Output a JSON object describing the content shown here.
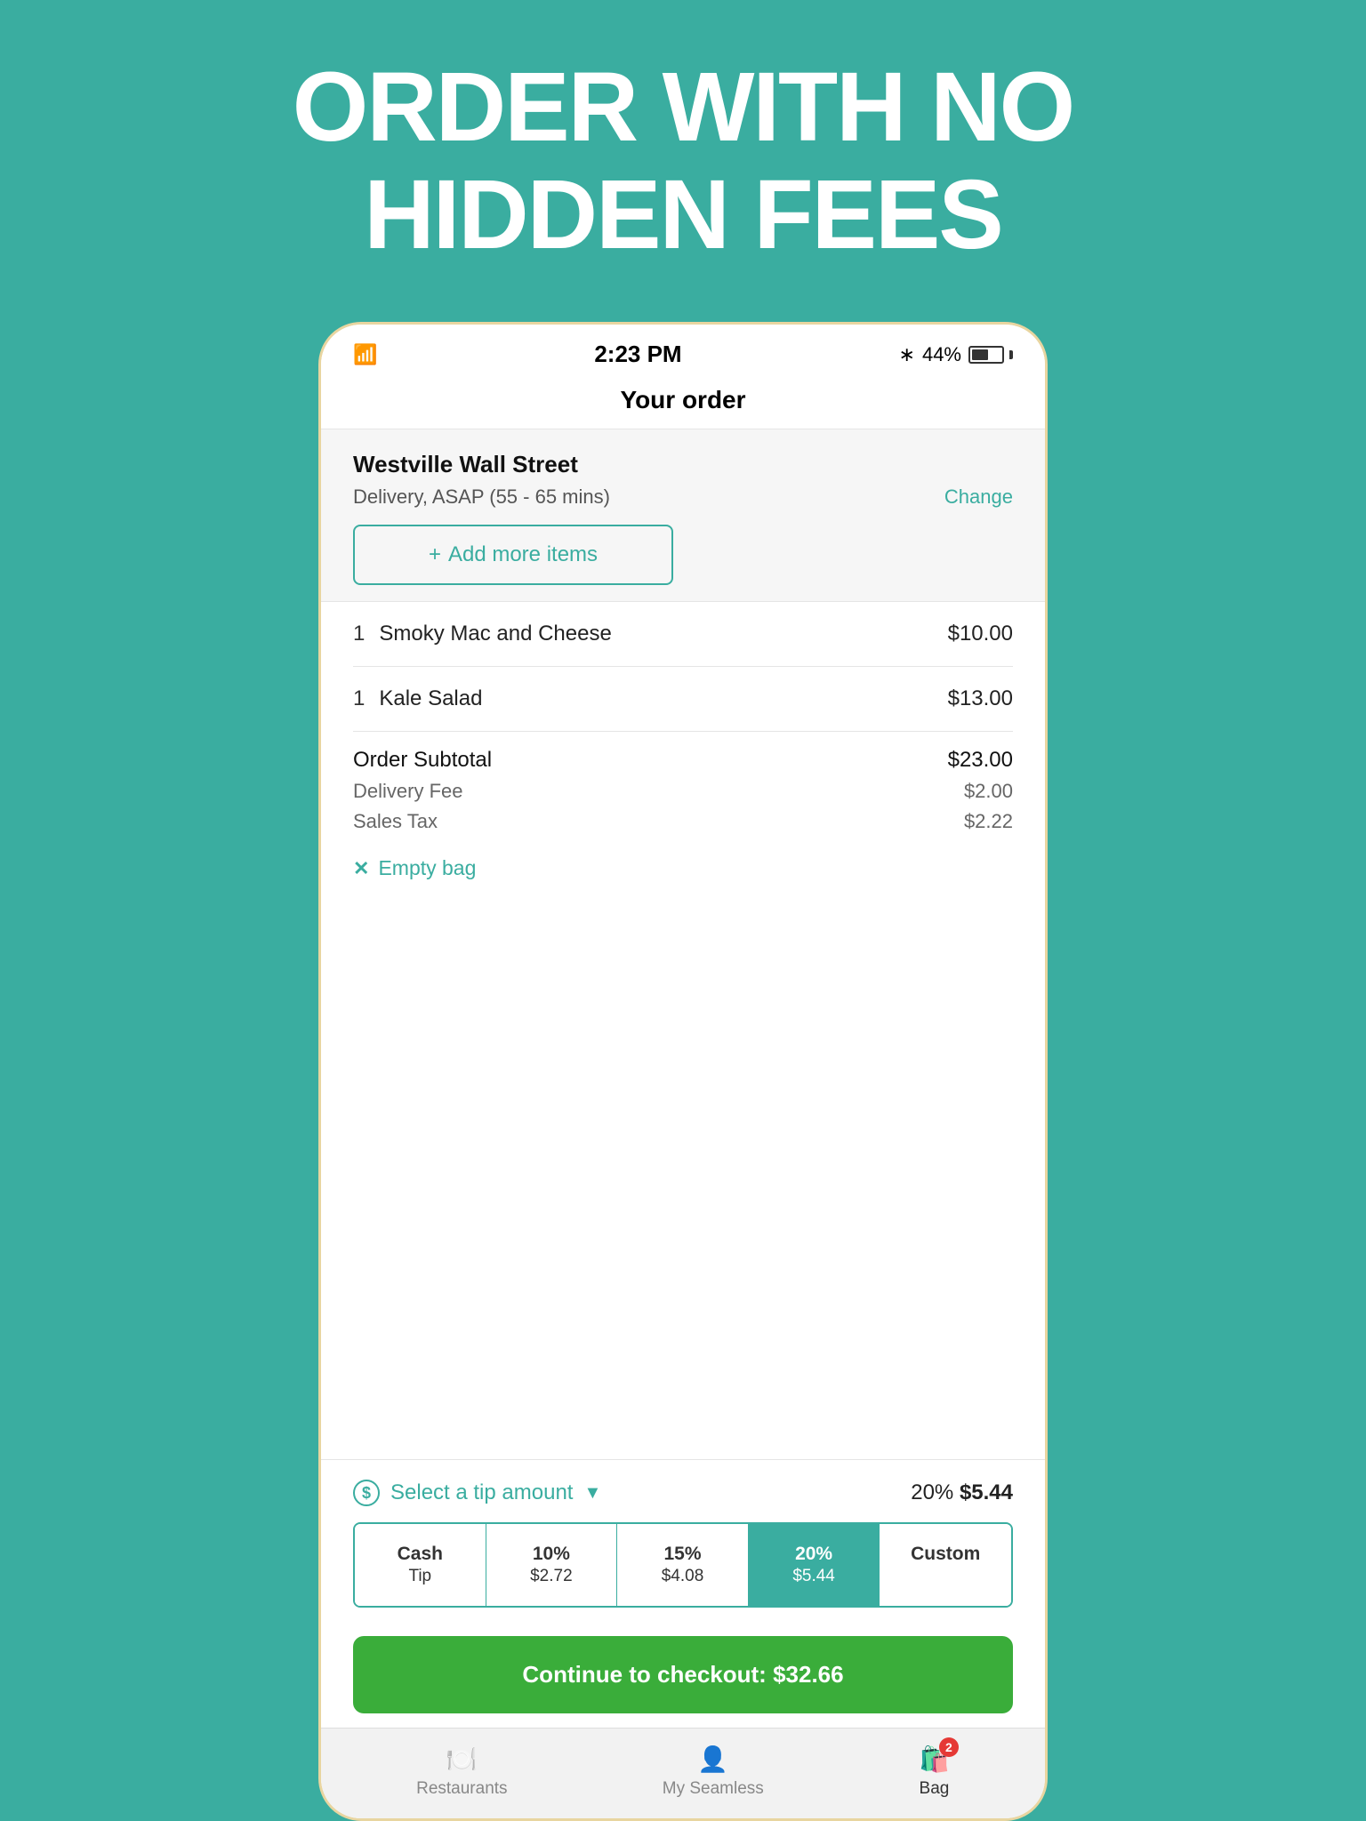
{
  "headline": {
    "line1": "ORDER WITH NO",
    "line2": "HIDDEN FEES"
  },
  "status_bar": {
    "time": "2:23 PM",
    "battery_pct": "44%"
  },
  "nav": {
    "title": "Your order"
  },
  "restaurant": {
    "name": "Westville Wall Street",
    "delivery_info": "Delivery, ASAP (55 - 65 mins)",
    "change_label": "Change"
  },
  "add_items": {
    "label": "Add more items",
    "icon": "+"
  },
  "order_items": [
    {
      "qty": "1",
      "name": "Smoky Mac and Cheese",
      "price": "$10.00"
    },
    {
      "qty": "1",
      "name": "Kale Salad",
      "price": "$13.00"
    }
  ],
  "subtotals": {
    "subtotal_label": "Order Subtotal",
    "subtotal_value": "$23.00",
    "delivery_label": "Delivery Fee",
    "delivery_value": "$2.00",
    "tax_label": "Sales Tax",
    "tax_value": "$2.22"
  },
  "empty_bag": {
    "label": "Empty bag"
  },
  "tip": {
    "select_label": "Select a tip amount",
    "percentage_label": "20%",
    "amount_label": "$5.44",
    "buttons": [
      {
        "label": "Cash\nTip",
        "pct": "Cash",
        "val": "Tip",
        "id": "cash"
      },
      {
        "label": "10%\n$2.72",
        "pct": "10%",
        "val": "$2.72",
        "id": "10pct"
      },
      {
        "label": "15%\n$4.08",
        "pct": "15%",
        "val": "$4.08",
        "id": "15pct"
      },
      {
        "label": "20%\n$5.44",
        "pct": "20%",
        "val": "$5.44",
        "id": "20pct",
        "active": true
      },
      {
        "label": "Custom",
        "pct": "Custom",
        "val": "",
        "id": "custom"
      }
    ]
  },
  "continue_btn": {
    "label": "Continue to checkout: $32.66"
  },
  "bottom_nav": {
    "items": [
      {
        "label": "Restaurants",
        "icon": "🍽️",
        "id": "restaurants"
      },
      {
        "label": "My Seamless",
        "icon": "👤",
        "id": "my-seamless"
      },
      {
        "label": "Bag",
        "icon": "🛍️",
        "id": "bag",
        "badge": "2",
        "active": true
      }
    ]
  }
}
